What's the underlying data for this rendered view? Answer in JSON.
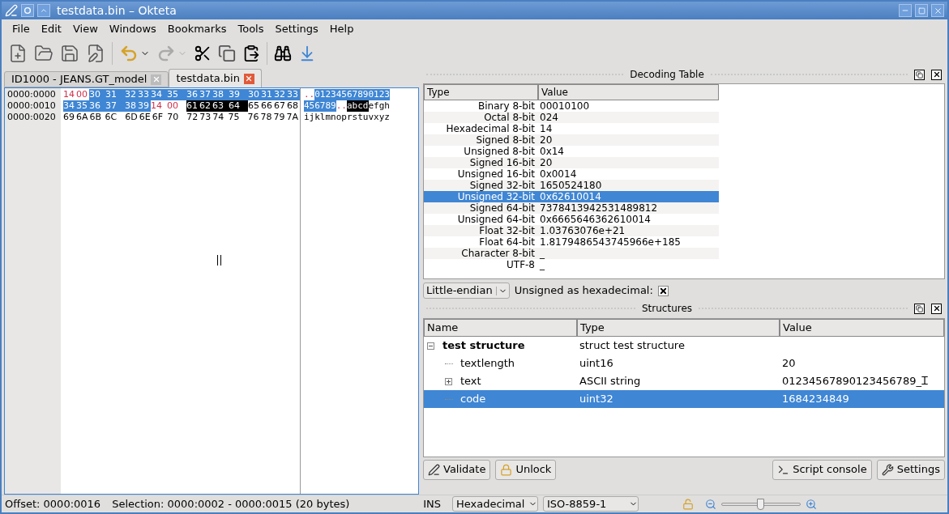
{
  "window": {
    "title": "testdata.bin – Okteta"
  },
  "menu": [
    "File",
    "Edit",
    "View",
    "Windows",
    "Bookmarks",
    "Tools",
    "Settings",
    "Help"
  ],
  "tabs": [
    {
      "label": "ID1000 - JEANS.GT_model",
      "selected": false
    },
    {
      "label": "testdata.bin",
      "selected": true
    }
  ],
  "hex_view": {
    "rows": [
      {
        "offset": "0000:0000",
        "bytes": [
          {
            "text": "14",
            "kind": "special"
          },
          {
            "text": "00",
            "kind": "special"
          },
          {
            "text": "30",
            "kind": "selected"
          },
          {
            "text": "31",
            "kind": "selected"
          },
          {
            "text": "32",
            "kind": "selected"
          },
          {
            "text": "33",
            "kind": "selected"
          },
          {
            "text": "34",
            "kind": "selected"
          },
          {
            "text": "35",
            "kind": "selected"
          },
          {
            "text": "36",
            "kind": "selected"
          },
          {
            "text": "37",
            "kind": "selected"
          },
          {
            "text": "38",
            "kind": "selected"
          },
          {
            "text": "39",
            "kind": "selected"
          },
          {
            "text": "30",
            "kind": "selected"
          },
          {
            "text": "31",
            "kind": "selected"
          },
          {
            "text": "32",
            "kind": "selected"
          },
          {
            "text": "33",
            "kind": "selected"
          }
        ],
        "chars": [
          {
            "text": "..",
            "kind": "special"
          },
          {
            "text": "01234567890123",
            "kind": "selected"
          }
        ]
      },
      {
        "offset": "0000:0010",
        "bytes": [
          {
            "text": "34",
            "kind": "selected"
          },
          {
            "text": "35",
            "kind": "selected"
          },
          {
            "text": "36",
            "kind": "selected"
          },
          {
            "text": "37",
            "kind": "selected"
          },
          {
            "text": "38",
            "kind": "selected"
          },
          {
            "text": "39",
            "kind": "selected"
          },
          {
            "text": "14",
            "kind": "special"
          },
          {
            "text": "00",
            "kind": "special"
          },
          {
            "text": "61",
            "kind": "marked"
          },
          {
            "text": "62",
            "kind": "marked"
          },
          {
            "text": "63",
            "kind": "marked"
          },
          {
            "text": "64",
            "kind": "marked"
          },
          {
            "text": "65",
            "kind": "plain"
          },
          {
            "text": "66",
            "kind": "plain"
          },
          {
            "text": "67",
            "kind": "plain"
          },
          {
            "text": "68",
            "kind": "plain"
          }
        ],
        "chars": [
          {
            "text": "456789",
            "kind": "selected"
          },
          {
            "text": "..",
            "kind": "special"
          },
          {
            "text": "abcd",
            "kind": "marked"
          },
          {
            "text": "efgh",
            "kind": "plain"
          }
        ]
      },
      {
        "offset": "0000:0020",
        "bytes": [
          {
            "text": "69",
            "kind": "plain"
          },
          {
            "text": "6A",
            "kind": "plain"
          },
          {
            "text": "6B",
            "kind": "plain"
          },
          {
            "text": "6C",
            "kind": "plain"
          },
          {
            "text": "6D",
            "kind": "plain"
          },
          {
            "text": "6E",
            "kind": "plain"
          },
          {
            "text": "6F",
            "kind": "plain"
          },
          {
            "text": "70",
            "kind": "plain"
          },
          {
            "text": "72",
            "kind": "plain"
          },
          {
            "text": "73",
            "kind": "plain"
          },
          {
            "text": "74",
            "kind": "plain"
          },
          {
            "text": "75",
            "kind": "plain"
          },
          {
            "text": "76",
            "kind": "plain"
          },
          {
            "text": "78",
            "kind": "plain"
          },
          {
            "text": "79",
            "kind": "plain"
          },
          {
            "text": "7A",
            "kind": "plain"
          }
        ],
        "chars": [
          {
            "text": "ijklmnoprstuvxyz",
            "kind": "plain"
          }
        ]
      }
    ]
  },
  "decoding_table": {
    "title": "Decoding Table",
    "columns": [
      "Type",
      "Value"
    ],
    "rows": [
      {
        "type": "Binary 8-bit",
        "value": "00010100",
        "selected": false
      },
      {
        "type": "Octal 8-bit",
        "value": "024",
        "selected": false
      },
      {
        "type": "Hexadecimal 8-bit",
        "value": "14",
        "selected": false
      },
      {
        "type": "Signed 8-bit",
        "value": "20",
        "selected": false
      },
      {
        "type": "Unsigned 8-bit",
        "value": "0x14",
        "selected": false
      },
      {
        "type": "Signed 16-bit",
        "value": "20",
        "selected": false
      },
      {
        "type": "Unsigned 16-bit",
        "value": "0x0014",
        "selected": false
      },
      {
        "type": "Signed 32-bit",
        "value": "1650524180",
        "selected": false
      },
      {
        "type": "Unsigned 32-bit",
        "value": "0x62610014",
        "selected": true
      },
      {
        "type": "Signed 64-bit",
        "value": "7378413942531489812",
        "selected": false
      },
      {
        "type": "Unsigned 64-bit",
        "value": "0x6665646362610014",
        "selected": false
      },
      {
        "type": "Float 32-bit",
        "value": "1.03763076e+21",
        "selected": false
      },
      {
        "type": "Float 64-bit",
        "value": "1.8179486543745966e+185",
        "selected": false
      },
      {
        "type": "Character 8-bit",
        "value": "_",
        "selected": false
      },
      {
        "type": "UTF-8",
        "value": "_",
        "selected": false
      }
    ],
    "endianness": "Little-endian",
    "hex_option": {
      "label": "Unsigned as hexadecimal:",
      "checked": true
    }
  },
  "structures": {
    "title": "Structures",
    "columns": [
      "Name",
      "Type",
      "Value"
    ],
    "rows": [
      {
        "name": "test structure",
        "type": "struct test structure",
        "value": "",
        "selected": false,
        "expanded": true,
        "children": [
          {
            "name": "textlength",
            "type": "uint16",
            "value": "20",
            "selected": false
          },
          {
            "name": "text",
            "type": "ASCII string",
            "value": "01234567890123456789_Ꮖ",
            "selected": false,
            "expanded": false
          },
          {
            "name": "code",
            "type": "uint32",
            "value": "1684234849",
            "selected": true
          }
        ]
      }
    ],
    "buttons": [
      "Validate",
      "Unlock",
      "Script console",
      "Settings"
    ]
  },
  "status_bar": {
    "offset": "Offset: 0000:0016",
    "selection": "Selection: 0000:0002 - 0000:0015 (20 bytes)",
    "mode": "INS",
    "encoding": "Hexadecimal",
    "charset": "ISO-8859-1",
    "zoom": {
      "level": 0.5
    }
  }
}
